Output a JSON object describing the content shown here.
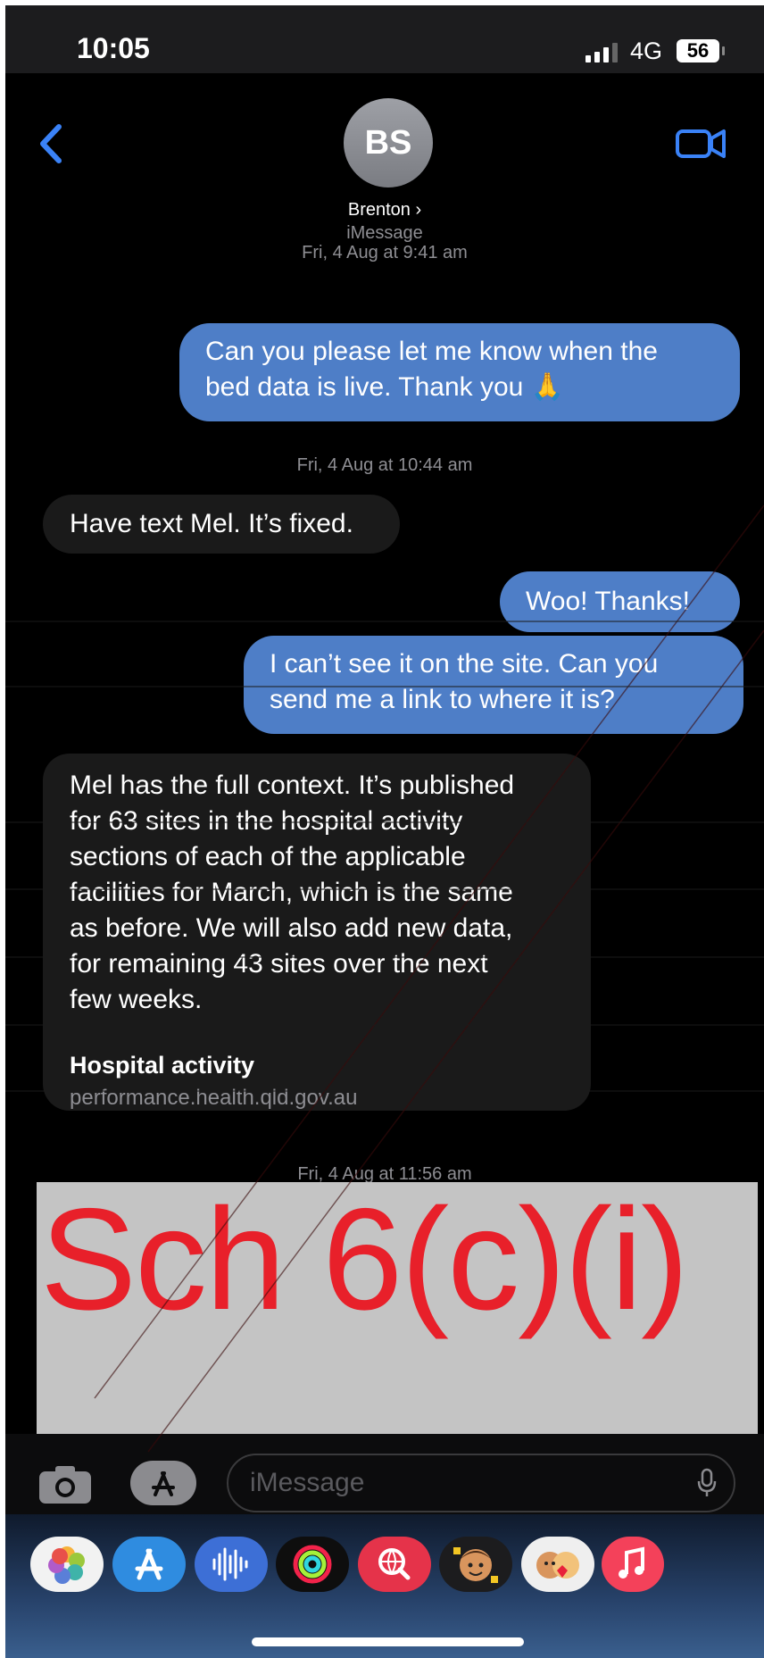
{
  "status_bar": {
    "time": "10:05",
    "network": "4G",
    "battery": "56"
  },
  "header": {
    "avatar_initials": "BS",
    "contact_name": "Brenton ›"
  },
  "thread": {
    "service_label": "iMessage",
    "timestamp_1": "Fri, 4 Aug at 9:41 am",
    "msg_1_line1": "Can you please let me know when the",
    "msg_1_line2": "bed data is live. Thank you 🙏",
    "timestamp_2": "Fri, 4 Aug at 10:44 am",
    "msg_2": "Have text Mel. It’s fixed.",
    "msg_3": "Woo! Thanks!",
    "msg_4_line1": "I can’t see it on the site. Can you",
    "msg_4_line2": "send me a link to where it is?",
    "msg_5_lines": [
      "Mel has the full context. It’s published",
      "for 63 sites in the hospital activity",
      "sections of each of the applicable",
      "facilities for March, which is the same",
      "as before. We will also add new data,",
      "for remaining 43 sites over the next",
      "few weeks."
    ],
    "link_title": "Hospital activity",
    "link_url": "performance.health.qld.gov.au",
    "timestamp_3": "Fri, 4 Aug at 11:56 am"
  },
  "redaction": {
    "label": "Sch 6(c)(i)"
  },
  "composer": {
    "placeholder": "iMessage"
  },
  "dock_apps": [
    "photos-app-icon",
    "app-store-icon",
    "audio-message-icon",
    "activity-icon",
    "image-search-icon",
    "avatar-sticker-icon",
    "memoji-icon",
    "music-icon"
  ],
  "colors": {
    "outgoing_bubble": "#4e7ec7",
    "incoming_bubble": "#1a1a1a",
    "redaction_text": "#e8202a",
    "redaction_box": "#c4c4c4",
    "accent": "#3a82f7"
  }
}
